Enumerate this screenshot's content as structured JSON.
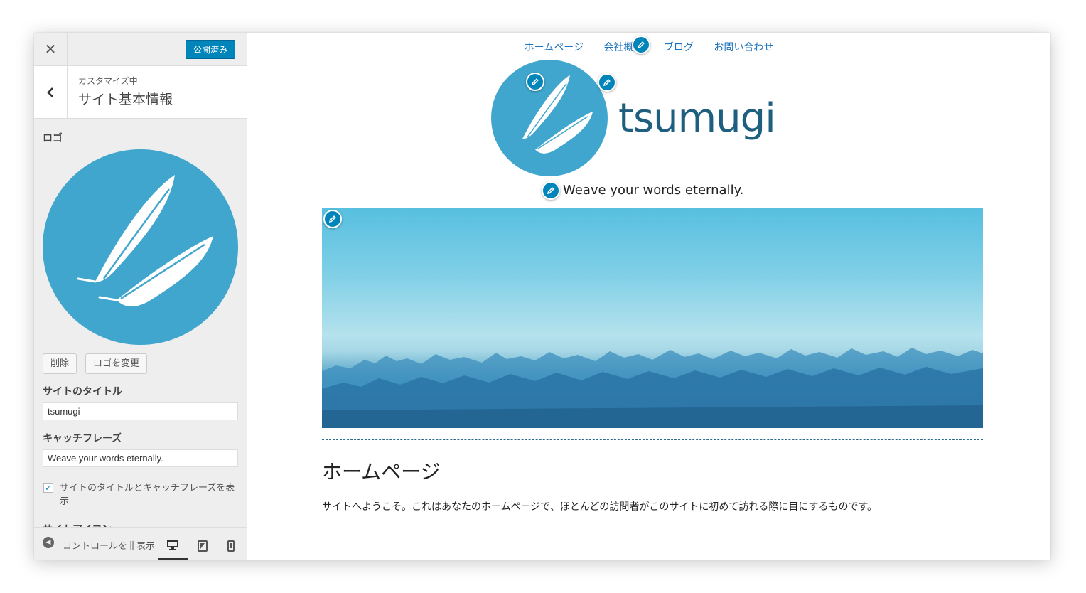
{
  "sidebar": {
    "close_symbol": "✕",
    "publish_label": "公開済み",
    "section_sub": "カスタマイズ中",
    "section_title": "サイト基本情報",
    "logo_label": "ロゴ",
    "remove_label": "削除",
    "change_logo_label": "ロゴを変更",
    "site_title_label": "サイトのタイトル",
    "site_title_value": "tsumugi",
    "tagline_label": "キャッチフレーズ",
    "tagline_value": "Weave your words eternally.",
    "display_checkbox_label": "サイトのタイトルとキャッチフレーズを表示",
    "display_checkbox_checked": true,
    "cut_off_label": "サイトアイコン",
    "collapse_label": "コントロールを非表示",
    "devices": [
      "desktop-icon",
      "tablet-icon",
      "mobile-icon"
    ]
  },
  "preview": {
    "nav": [
      "ホームページ",
      "会社概要",
      "ブログ",
      "お問い合わせ"
    ],
    "site_title": "tsumugi",
    "tagline": "Weave your words eternally.",
    "page_title": "ホームページ",
    "page_content": "サイトへようこそ。これはあなたのホームページで、ほとんどの訪問者がこのサイトに初めて訪れる際に目にするものです。"
  },
  "colors": {
    "accent": "#0085ba",
    "logo_bg": "#41a6cd",
    "wordmark": "#1e5f80",
    "link": "#1e73be"
  }
}
